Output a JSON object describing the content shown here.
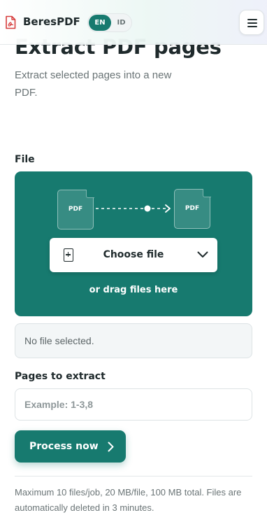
{
  "header": {
    "brand": "BeresPDF",
    "lang_options": [
      "EN",
      "ID"
    ],
    "lang_selected": "EN",
    "menu_icon": "hamburger-menu-icon",
    "logo_icon": "pdf-document-icon",
    "accent_color": "#177a6f"
  },
  "main": {
    "title": "Extract PDF pages",
    "subtitle": "Extract selected pages into a new PDF.",
    "file_section": {
      "label": "File",
      "dropzone": {
        "doc_label_left": "PDF",
        "doc_label_right": "PDF",
        "choose_label": "Choose file",
        "drag_text": "or drag files here",
        "icons": [
          "pdf-file-icon",
          "arrow-flow-icon",
          "add-file-icon",
          "chevron-down-icon"
        ]
      },
      "status": "No file selected."
    },
    "pages_section": {
      "label": "Pages to extract",
      "input_value": "",
      "placeholder": "Example: 1-3,8"
    },
    "process_button": {
      "label": "Process now",
      "icon": "chevron-right-icon"
    },
    "footnote": "Maximum 10 files/job, 20 MB/file, 100 MB total. Files are automatically deleted in 3 minutes."
  }
}
